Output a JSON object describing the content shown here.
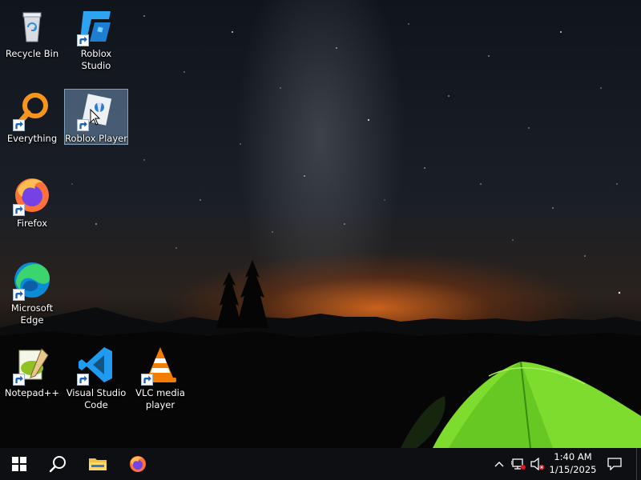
{
  "desktop": {
    "icons": [
      {
        "label": "Recycle Bin",
        "icon": "recycle-bin-icon"
      },
      {
        "label": "Roblox Studio",
        "icon": "roblox-studio-icon"
      },
      {
        "label": "Everything",
        "icon": "everything-search-icon"
      },
      {
        "label": "Roblox Player",
        "icon": "roblox-player-icon",
        "selected": true
      },
      {
        "label": "Firefox",
        "icon": "firefox-icon"
      },
      {
        "label": "Microsoft Edge",
        "icon": "edge-icon"
      },
      {
        "label": "Notepad++",
        "icon": "notepad-plus-plus-icon"
      },
      {
        "label": "Visual Studio Code",
        "icon": "vscode-icon"
      },
      {
        "label": "VLC media player",
        "icon": "vlc-icon"
      }
    ]
  },
  "taskbar": {
    "pinned": [
      "start-icon",
      "search-icon",
      "file-explorer-icon",
      "firefox-icon"
    ],
    "tray": {
      "time": "1:40 AM",
      "date": "1/15/2025",
      "icons": [
        "chevron-up-icon",
        "network-icon",
        "volume-muted-icon",
        "notification-icon"
      ]
    }
  },
  "colors": {
    "taskbar": "#0d0f12",
    "tent": "#7ddc2e",
    "sky_glow": "#ff7a1e",
    "selection": "#82aad2"
  }
}
